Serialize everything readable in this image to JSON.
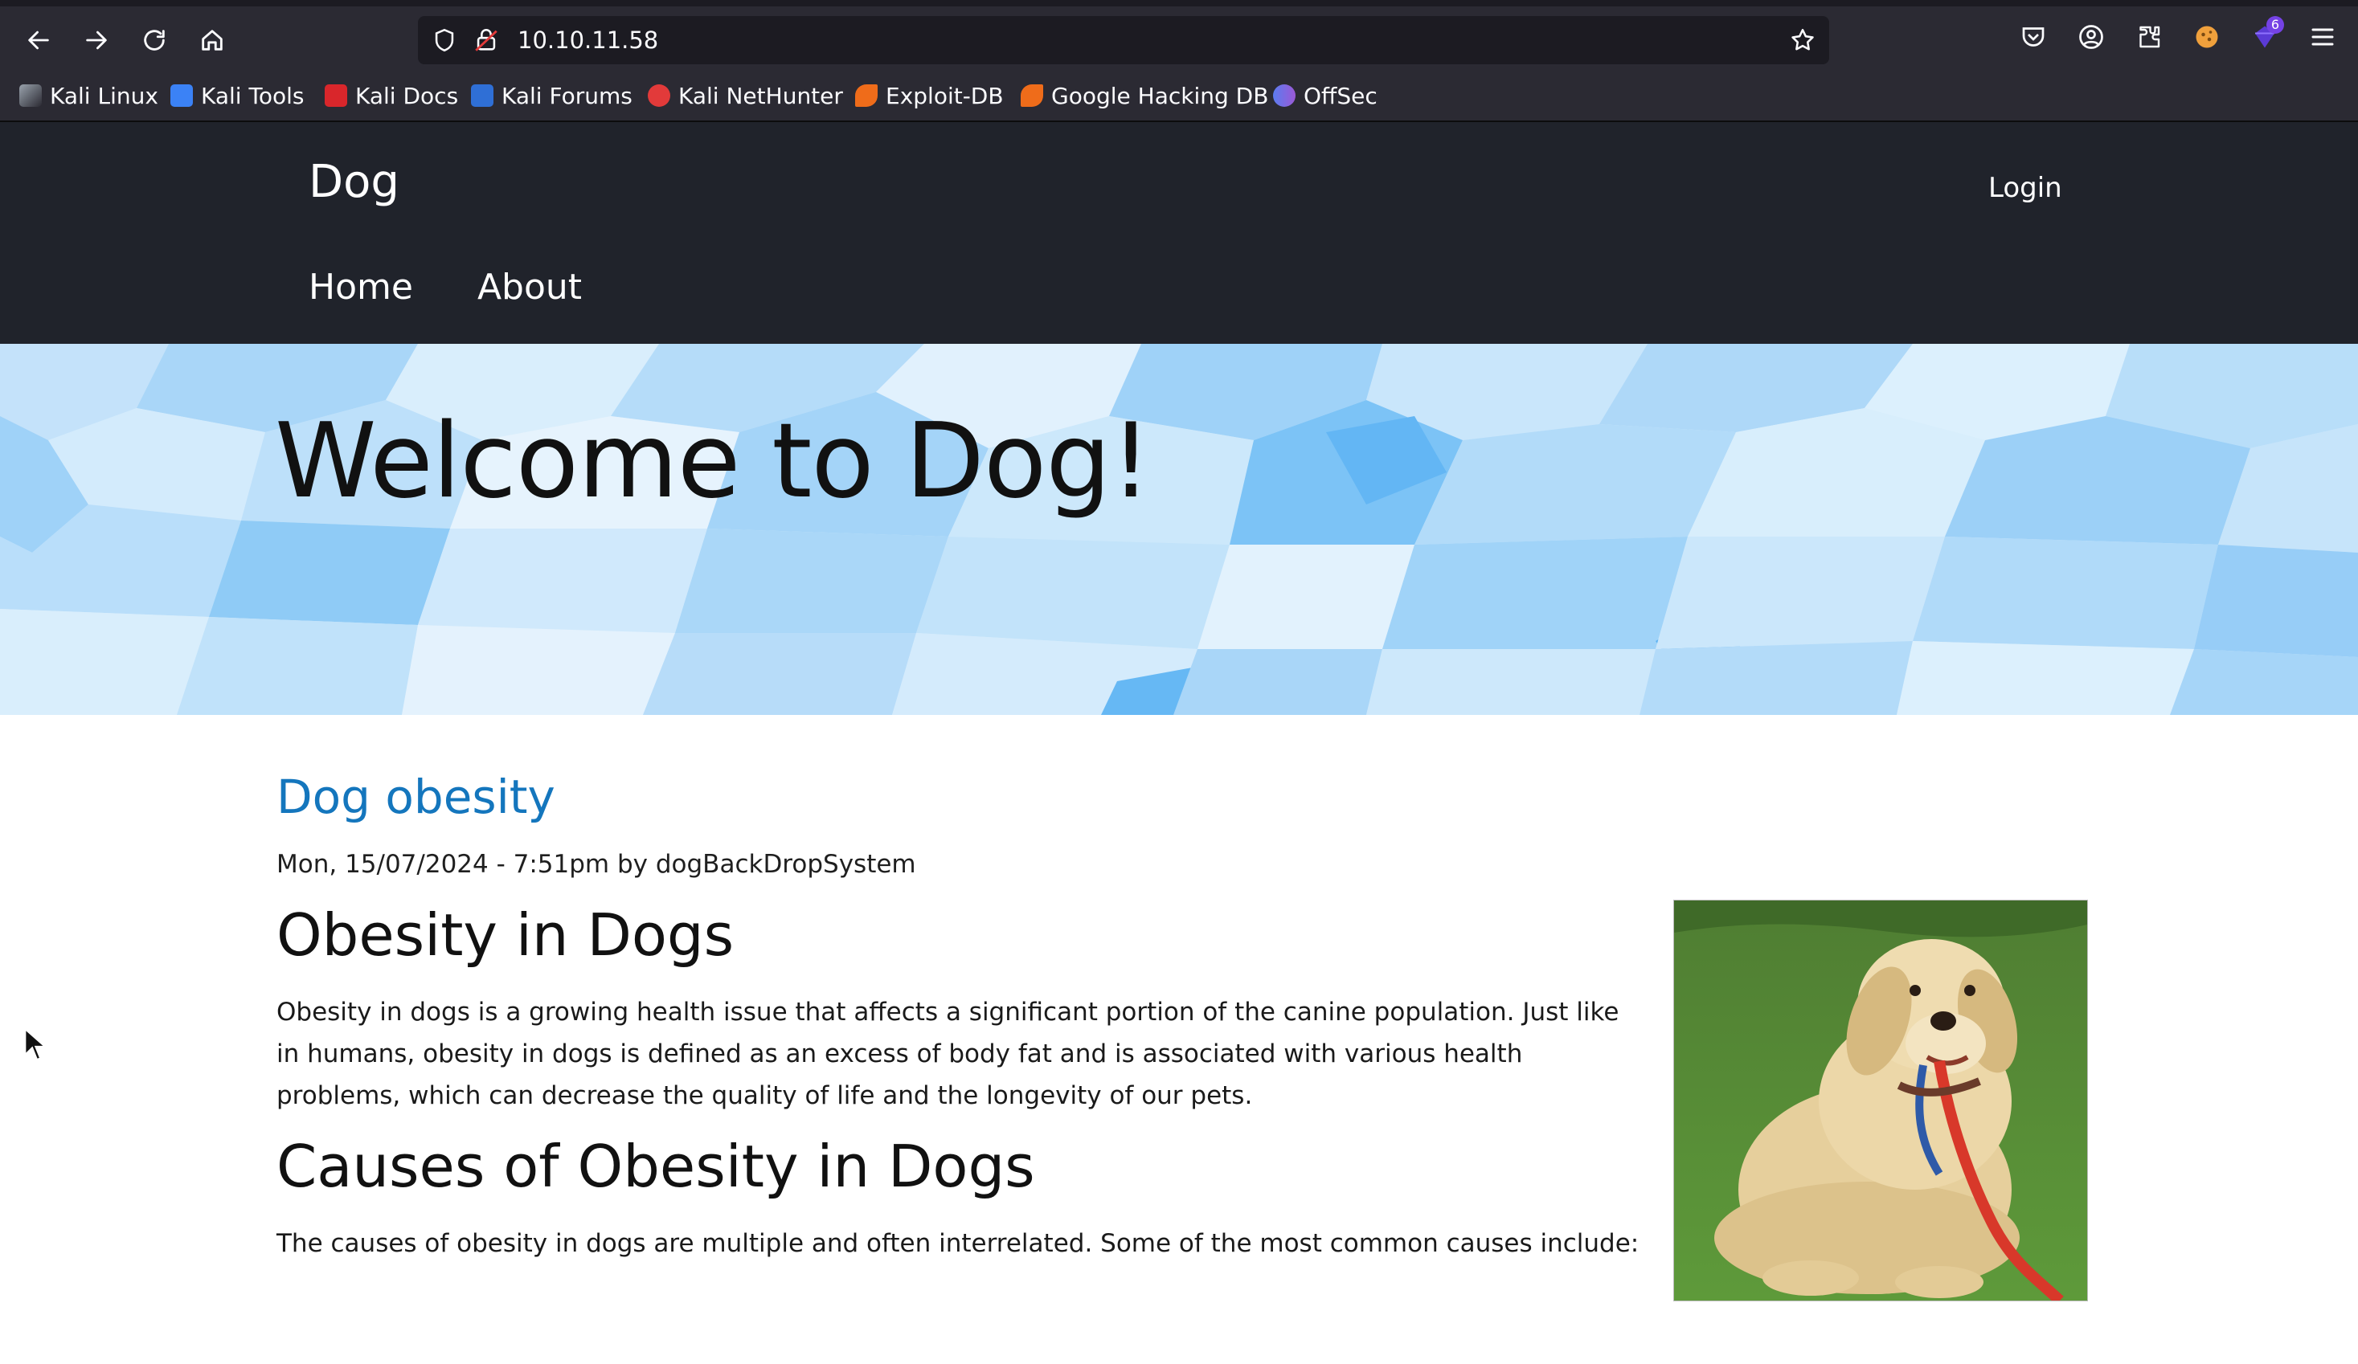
{
  "browser": {
    "url": "10.10.11.58",
    "extension_badge": "6",
    "bookmarks": [
      {
        "label": "Kali Linux",
        "icon": "kali-dragon-icon",
        "color": "#367bf0"
      },
      {
        "label": "Kali Tools",
        "icon": "kali-tools-icon",
        "color": "#3b82f6"
      },
      {
        "label": "Kali Docs",
        "icon": "kali-docs-icon",
        "color": "#d9262b"
      },
      {
        "label": "Kali Forums",
        "icon": "kali-forums-icon",
        "color": "#2f6fd6"
      },
      {
        "label": "Kali NetHunter",
        "icon": "nethunter-icon",
        "color": "#e23a3a"
      },
      {
        "label": "Exploit-DB",
        "icon": "exploit-db-icon",
        "color": "#ef6c1a"
      },
      {
        "label": "Google Hacking DB",
        "icon": "ghdb-icon",
        "color": "#ef6c1a"
      },
      {
        "label": "OffSec",
        "icon": "offsec-icon",
        "color": "#5b7cf0"
      }
    ]
  },
  "site": {
    "name": "Dog",
    "login_label": "Login",
    "nav": [
      {
        "label": "Home"
      },
      {
        "label": "About"
      }
    ]
  },
  "hero": {
    "title": "Welcome to Dog!"
  },
  "article": {
    "title": "Dog obesity",
    "meta": "Mon, 15/07/2024 - 7:51pm by dogBackDropSystem",
    "heading1": "Obesity in Dogs",
    "paragraph1": "Obesity in dogs is a growing health issue that affects a significant portion of the canine population. Just like in humans, obesity in dogs is defined as an excess of body fat and is associated with various health problems, which can decrease the quality of life and the longevity of our pets.",
    "heading2": "Causes of Obesity in Dogs",
    "paragraph2": "The causes of obesity in dogs are multiple and often interrelated. Some of the most common causes include:"
  },
  "colors": {
    "header_bg": "#20232b",
    "link": "#1476bd",
    "hero_sky": "#d6ebfb"
  }
}
